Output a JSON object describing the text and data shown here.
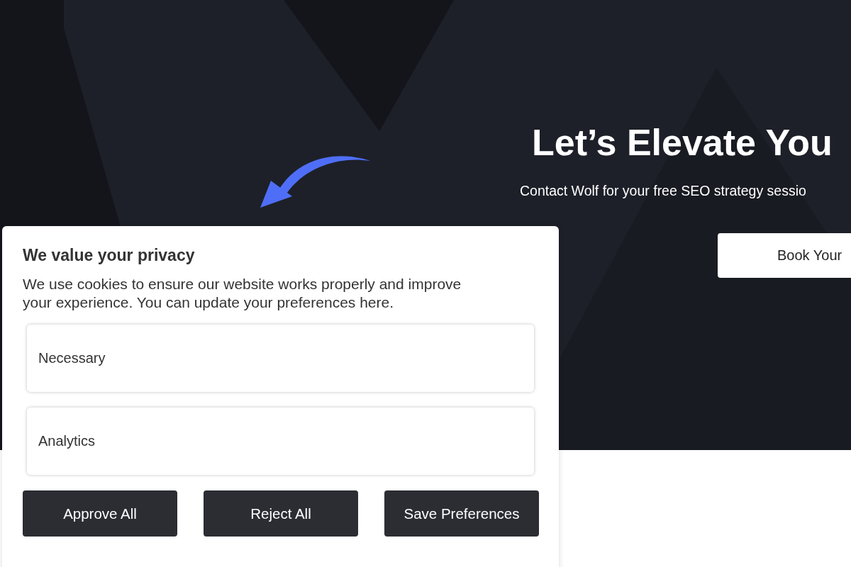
{
  "hero": {
    "heading": "Let’s Elevate You",
    "subtitle": "Contact Wolf for your free SEO strategy sessio",
    "button": "Book Your"
  },
  "consent": {
    "title": "We value your privacy",
    "text": "We use cookies to ensure our website works properly and improve your experience. You can update your preferences here.",
    "categories": [
      {
        "label": "Necessary"
      },
      {
        "label": "Analytics"
      }
    ],
    "buttons": [
      "Approve All",
      "Reject All",
      "Save Preferences"
    ]
  }
}
